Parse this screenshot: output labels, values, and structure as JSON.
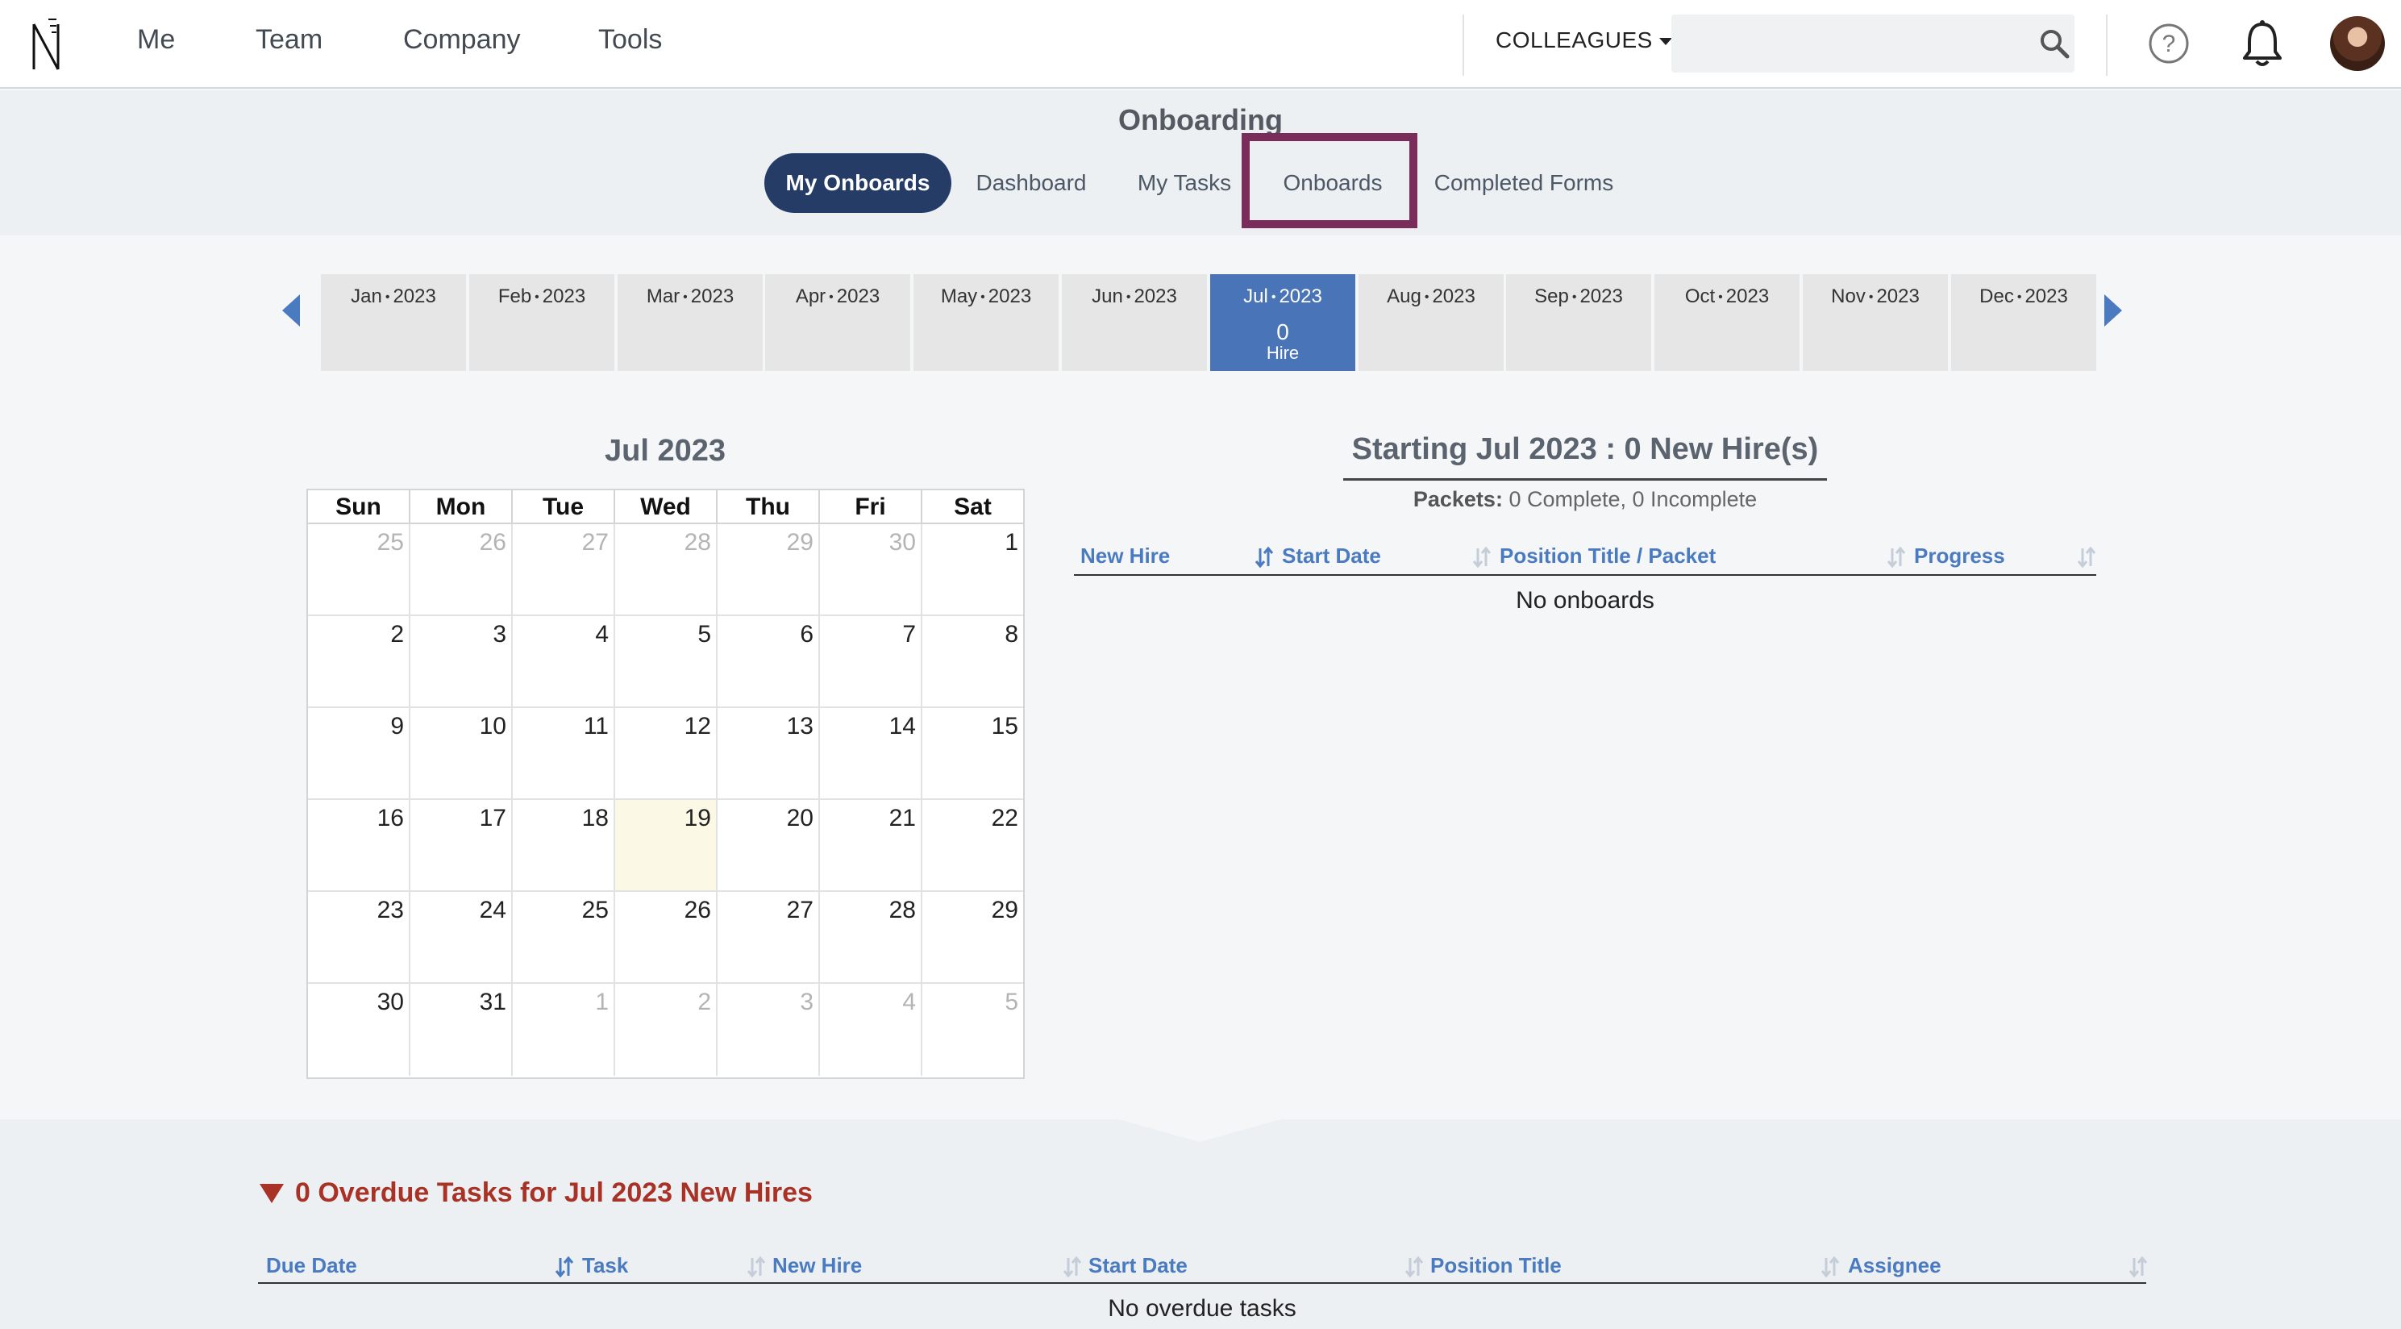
{
  "nav": {
    "links": [
      "Me",
      "Team",
      "Company",
      "Tools"
    ],
    "colleagues_label": "COLLEAGUES",
    "search_placeholder": ""
  },
  "header": {
    "title": "Onboarding",
    "tabs": [
      "My Onboards",
      "Dashboard",
      "My Tasks",
      "Onboards",
      "Completed Forms"
    ],
    "active_tab": "My Onboards"
  },
  "months": [
    {
      "label": "Jan",
      "year": "2023"
    },
    {
      "label": "Feb",
      "year": "2023"
    },
    {
      "label": "Mar",
      "year": "2023"
    },
    {
      "label": "Apr",
      "year": "2023"
    },
    {
      "label": "May",
      "year": "2023"
    },
    {
      "label": "Jun",
      "year": "2023"
    },
    {
      "label": "Jul",
      "year": "2023",
      "count": "0",
      "unit": "Hire"
    },
    {
      "label": "Aug",
      "year": "2023"
    },
    {
      "label": "Sep",
      "year": "2023"
    },
    {
      "label": "Oct",
      "year": "2023"
    },
    {
      "label": "Nov",
      "year": "2023"
    },
    {
      "label": "Dec",
      "year": "2023"
    }
  ],
  "calendar": {
    "title": "Jul 2023",
    "days": [
      "Sun",
      "Mon",
      "Tue",
      "Wed",
      "Thu",
      "Fri",
      "Sat"
    ],
    "weeks": [
      [
        "25",
        "26",
        "27",
        "28",
        "29",
        "30",
        "1"
      ],
      [
        "2",
        "3",
        "4",
        "5",
        "6",
        "7",
        "8"
      ],
      [
        "9",
        "10",
        "11",
        "12",
        "13",
        "14",
        "15"
      ],
      [
        "16",
        "17",
        "18",
        "19",
        "20",
        "21",
        "22"
      ],
      [
        "23",
        "24",
        "25",
        "26",
        "27",
        "28",
        "29"
      ],
      [
        "30",
        "31",
        "1",
        "2",
        "3",
        "4",
        "5"
      ]
    ]
  },
  "starting": {
    "title": "Starting Jul 2023 : 0 New Hire(s)",
    "packets_label": "Packets:",
    "packets_value": "0 Complete, 0 Incomplete",
    "columns": [
      "New Hire",
      "Start Date",
      "Position Title / Packet",
      "Progress"
    ],
    "empty": "No onboards"
  },
  "overdue": {
    "title": "0 Overdue Tasks for Jul 2023 New Hires",
    "columns": [
      "Due Date",
      "Task",
      "New Hire",
      "Start Date",
      "Position Title",
      "Assignee"
    ],
    "empty": "No overdue tasks"
  },
  "colors": {
    "accent_blue": "#4a7bc0",
    "active_tab": "#253c66",
    "active_month": "#4a74b8",
    "overdue_red": "#a93226",
    "highlight_box": "#7a2d5a",
    "today_cell": "#fbf8e6"
  }
}
